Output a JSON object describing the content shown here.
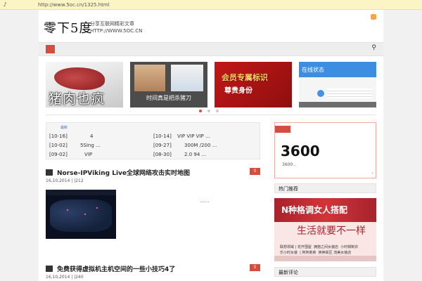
{
  "browser": {
    "url": "http://www.5oc.cn/1325.html"
  },
  "site": {
    "logo": "零下5度",
    "slogan_line1": "分享互联网精彩文章",
    "slogan_line2": "HTTP://WWW.5OC.CN"
  },
  "slider": [
    {
      "caption": "猪肉也疯"
    },
    {
      "caption": "时间真是把杀猪刀"
    },
    {
      "caption": "会员专属标识",
      "caption2": "尊贵身份"
    },
    {
      "caption": "在线状态"
    }
  ],
  "ticker": {
    "head": "最新",
    "items": [
      {
        "date": "[10-16]",
        "text": "4"
      },
      {
        "date": "[10-14]",
        "text": "VIP   VIP   VIP  ..."
      },
      {
        "date": "[10-02]",
        "text": "5Sing   ..."
      },
      {
        "date": "[09-27]",
        "text": "300M  /200  ..."
      },
      {
        "date": "[09-02]",
        "text": "VIP"
      },
      {
        "date": "[08-30]",
        "text": "2.0   94  ..."
      }
    ]
  },
  "posts": [
    {
      "title": "Norse-IPViking Live全球网络攻击实时地图",
      "meta": "16,10,2014 |   |212",
      "comments": "0",
      "excerpt": "......"
    },
    {
      "title": "免费获得虚拟机主机空间的一些小技巧4了",
      "meta": "16,10,2014 |   |240",
      "comments": "0"
    }
  ],
  "counter": {
    "value": "3600",
    "sub": "3600          ,"
  },
  "sidebar": {
    "head1": "热门推荐",
    "banner_title": "N种格调女人搭配",
    "banner_slogan": "生活就要不一样",
    "banner_small": "联想领域 | 花开围屋  拥抱之间女装店  小时候制衣\n乐小时女装  | 阿阿莉莉  换换街区 流美女装店",
    "head2": "最新评论"
  }
}
